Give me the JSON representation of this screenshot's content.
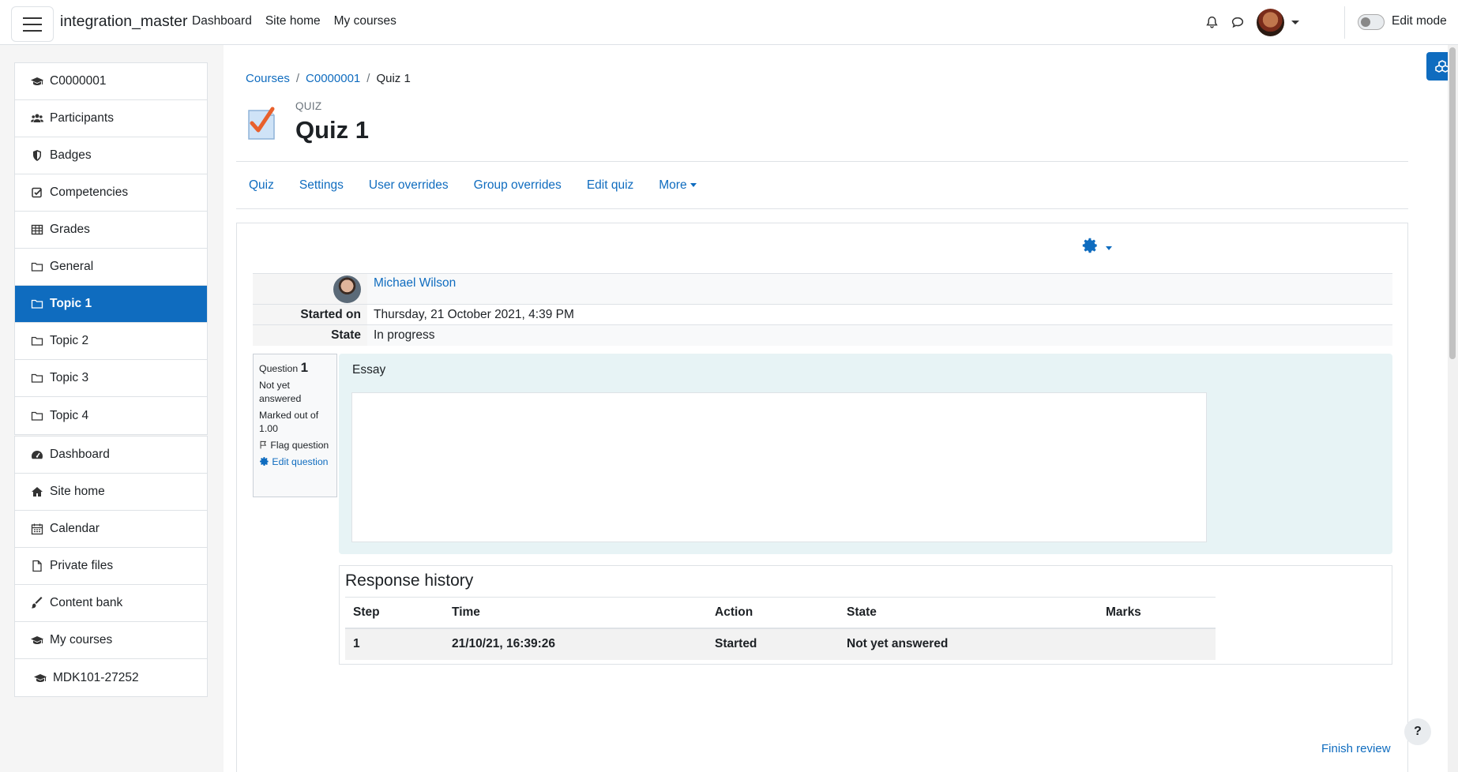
{
  "navbar": {
    "site_name": "integration_master",
    "links": [
      "Dashboard",
      "Site home",
      "My courses"
    ],
    "edit_mode_label": "Edit mode"
  },
  "drawer": {
    "course_items": [
      {
        "label": "C0000001",
        "icon": "graduation-cap-icon"
      },
      {
        "label": "Participants",
        "icon": "users-icon"
      },
      {
        "label": "Badges",
        "icon": "shield-icon"
      },
      {
        "label": "Competencies",
        "icon": "check-square-icon"
      },
      {
        "label": "Grades",
        "icon": "table-icon"
      },
      {
        "label": "General",
        "icon": "folder-icon"
      },
      {
        "label": "Topic 1",
        "icon": "folder-icon",
        "active": true
      },
      {
        "label": "Topic 2",
        "icon": "folder-icon"
      },
      {
        "label": "Topic 3",
        "icon": "folder-icon"
      },
      {
        "label": "Topic 4",
        "icon": "folder-icon"
      }
    ],
    "site_items": [
      {
        "label": "Dashboard",
        "icon": "tachometer-icon"
      },
      {
        "label": "Site home",
        "icon": "home-icon"
      },
      {
        "label": "Calendar",
        "icon": "calendar-icon"
      },
      {
        "label": "Private files",
        "icon": "file-icon"
      },
      {
        "label": "Content bank",
        "icon": "brush-icon"
      },
      {
        "label": "My courses",
        "icon": "graduation-cap-icon"
      },
      {
        "label": "MDK101-27252",
        "icon": "graduation-cap-icon"
      }
    ]
  },
  "breadcrumb": [
    "Courses",
    "C0000001",
    "Quiz 1"
  ],
  "page": {
    "type_label": "QUIZ",
    "title": "Quiz 1"
  },
  "secondary_nav": [
    "Quiz",
    "Settings",
    "User overrides",
    "Group overrides",
    "Edit quiz",
    "More"
  ],
  "attempt_summary": {
    "user_name": "Michael Wilson",
    "started_on_label": "Started on",
    "started_on_value": "Thursday, 21 October 2021, 4:39 PM",
    "state_label": "State",
    "state_value": "In progress"
  },
  "question_info": {
    "question_label": "Question",
    "number": "1",
    "status": "Not yet answered",
    "marked_out_of": "Marked out of 1.00",
    "flag_label": "Flag question",
    "edit_label": "Edit question"
  },
  "question": {
    "text": "Essay"
  },
  "response_history": {
    "title": "Response history",
    "columns": [
      "Step",
      "Time",
      "Action",
      "State",
      "Marks"
    ],
    "rows": [
      [
        "1",
        "21/10/21, 16:39:26",
        "Started",
        "Not yet answered",
        ""
      ]
    ]
  },
  "finish_review_label": "Finish review",
  "help_label": "?",
  "colors": {
    "accent": "#0f6cbf",
    "question_bg": "#e7f3f5"
  }
}
